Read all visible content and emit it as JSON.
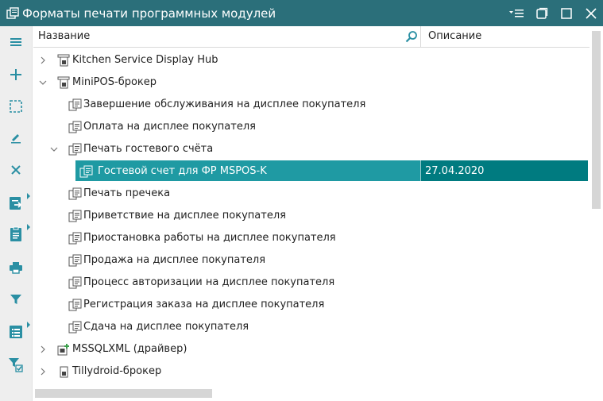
{
  "window": {
    "title": "Форматы печати программных модулей",
    "accent_color": "#2b6f7a",
    "controls": [
      "menu-icon",
      "restore-icon",
      "maximize-icon",
      "close-icon"
    ]
  },
  "toolbar": {
    "buttons": [
      {
        "name": "menu",
        "icon": "hamburger-icon"
      },
      {
        "name": "add",
        "icon": "plus-icon"
      },
      {
        "name": "select",
        "icon": "dashed-select-icon"
      },
      {
        "name": "edit",
        "icon": "pencil-icon"
      },
      {
        "name": "delete",
        "icon": "x-icon"
      },
      {
        "name": "export",
        "icon": "export-icon",
        "has_menu": true
      },
      {
        "name": "document",
        "icon": "document-icon",
        "has_menu": true
      },
      {
        "name": "print",
        "icon": "printer-icon"
      },
      {
        "name": "filter",
        "icon": "filter-icon"
      },
      {
        "name": "list",
        "icon": "list-icon",
        "has_menu": true
      },
      {
        "name": "filter-check",
        "icon": "filter-check-icon"
      }
    ]
  },
  "grid": {
    "columns": {
      "name": "Название",
      "description": "Описание"
    },
    "selection_color": "#1f9aa3",
    "rows": [
      {
        "label": "Kitchen Service Display Hub",
        "level": 0,
        "state": "collapsed",
        "icon": "module-icon",
        "desc": ""
      },
      {
        "label": "MiniPOS-брокер",
        "level": 0,
        "state": "expanded",
        "icon": "module-icon",
        "desc": ""
      },
      {
        "label": "Завершение обслуживания на дисплее покупателя",
        "level": 1,
        "state": "leaf",
        "icon": "format-icon",
        "desc": ""
      },
      {
        "label": "Оплата на дисплее покупателя",
        "level": 1,
        "state": "leaf",
        "icon": "format-icon",
        "desc": ""
      },
      {
        "label": "Печать гостевого счёта",
        "level": 1,
        "state": "expanded",
        "icon": "format-icon",
        "desc": ""
      },
      {
        "label": "Гостевой счет для ФР MSPOS-K",
        "level": 2,
        "state": "leaf",
        "icon": "format-icon",
        "desc": "27.04.2020",
        "selected": true
      },
      {
        "label": "Печать пречека",
        "level": 1,
        "state": "leaf",
        "icon": "format-icon",
        "desc": ""
      },
      {
        "label": "Приветствие на дисплее покупателя",
        "level": 1,
        "state": "leaf",
        "icon": "format-icon",
        "desc": ""
      },
      {
        "label": "Приостановка работы на дисплее покупателя",
        "level": 1,
        "state": "leaf",
        "icon": "format-icon",
        "desc": ""
      },
      {
        "label": "Продажа на дисплее покупателя",
        "level": 1,
        "state": "leaf",
        "icon": "format-icon",
        "desc": ""
      },
      {
        "label": "Процесс авторизации на дисплее покупателя",
        "level": 1,
        "state": "leaf",
        "icon": "format-icon",
        "desc": ""
      },
      {
        "label": "Регистрация заказа на дисплее покупателя",
        "level": 1,
        "state": "leaf",
        "icon": "format-icon",
        "desc": ""
      },
      {
        "label": "Сдача на дисплее покупателя",
        "level": 1,
        "state": "leaf",
        "icon": "format-icon",
        "desc": ""
      },
      {
        "label": "MSSQLXML (драйвер)",
        "level": 0,
        "state": "collapsed",
        "icon": "driver-icon",
        "desc": ""
      },
      {
        "label": "Tillydroid-брокер",
        "level": 0,
        "state": "collapsed",
        "icon": "module-icon",
        "desc": ""
      }
    ]
  }
}
